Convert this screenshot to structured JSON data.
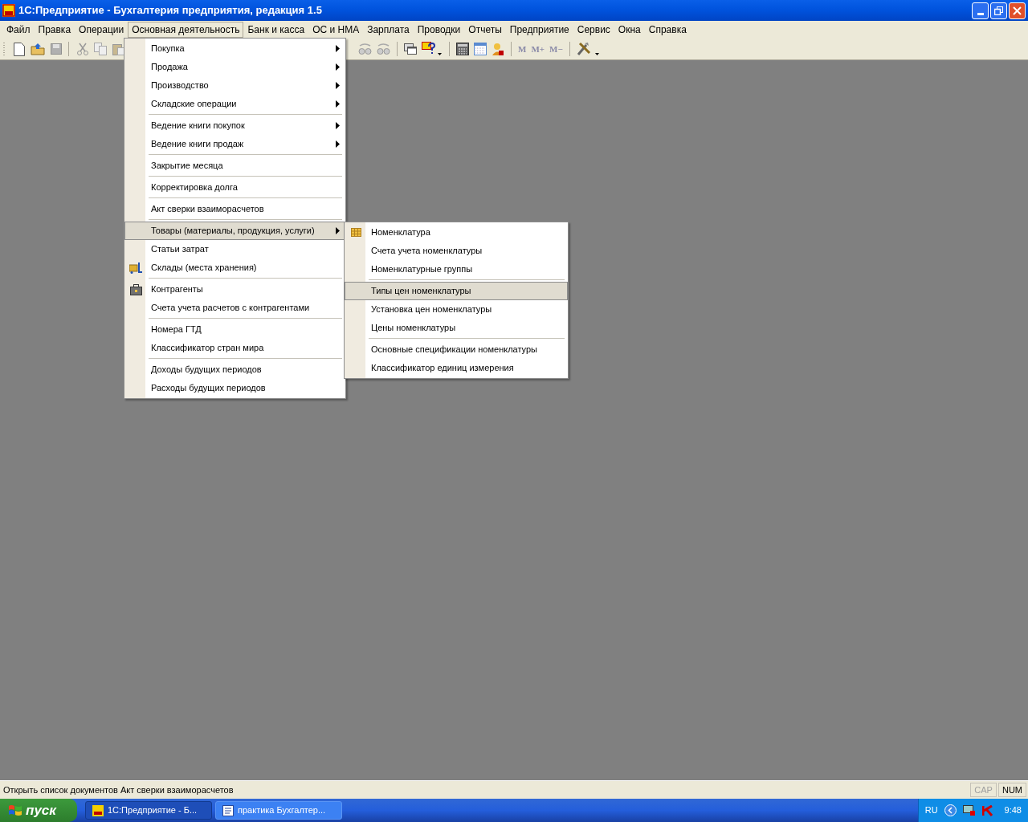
{
  "window": {
    "title": "1С:Предприятие - Бухгалтерия предприятия, редакция 1.5"
  },
  "menu_bar": [
    {
      "label": "Файл",
      "selected": false
    },
    {
      "label": "Правка",
      "selected": false
    },
    {
      "label": "Операции",
      "selected": false
    },
    {
      "label": "Основная деятельность",
      "selected": true
    },
    {
      "label": "Банк и касса",
      "selected": false
    },
    {
      "label": "ОС и НМА",
      "selected": false
    },
    {
      "label": "Зарплата",
      "selected": false
    },
    {
      "label": "Проводки",
      "selected": false
    },
    {
      "label": "Отчеты",
      "selected": false
    },
    {
      "label": "Предприятие",
      "selected": false
    },
    {
      "label": "Сервис",
      "selected": false
    },
    {
      "label": "Окна",
      "selected": false
    },
    {
      "label": "Справка",
      "selected": false
    }
  ],
  "toolbar": {
    "memory_buttons": [
      "M",
      "M+",
      "M−"
    ]
  },
  "menu": {
    "sections": [
      [
        {
          "label": "Покупка",
          "submenu": true,
          "selected": false
        },
        {
          "label": "Продажа",
          "submenu": true,
          "selected": false
        },
        {
          "label": "Производство",
          "submenu": true,
          "selected": false
        },
        {
          "label": "Складские операции",
          "submenu": true,
          "selected": false
        }
      ],
      [
        {
          "label": "Ведение книги покупок",
          "submenu": true,
          "selected": false
        },
        {
          "label": "Ведение книги продаж",
          "submenu": true,
          "selected": false
        }
      ],
      [
        {
          "label": "Закрытие месяца",
          "submenu": false,
          "selected": false
        }
      ],
      [
        {
          "label": "Корректировка долга",
          "submenu": false,
          "selected": false
        }
      ],
      [
        {
          "label": "Акт сверки взаиморасчетов",
          "submenu": false,
          "selected": false
        }
      ],
      [
        {
          "label": "Товары (материалы, продукция, услуги)",
          "submenu": true,
          "selected": true
        },
        {
          "label": "Статьи затрат",
          "submenu": false,
          "selected": false
        },
        {
          "label": "Склады (места хранения)",
          "submenu": false,
          "selected": false,
          "kind": "warehouse"
        }
      ],
      [
        {
          "label": "Контрагенты",
          "submenu": false,
          "selected": false,
          "kind": "briefcase"
        },
        {
          "label": "Счета учета расчетов с контрагентами",
          "submenu": false,
          "selected": false
        }
      ],
      [
        {
          "label": "Номера ГТД",
          "submenu": false,
          "selected": false
        },
        {
          "label": "Классификатор стран мира",
          "submenu": false,
          "selected": false
        }
      ],
      [
        {
          "label": "Доходы будущих периодов",
          "submenu": false,
          "selected": false
        },
        {
          "label": "Расходы будущих периодов",
          "submenu": false,
          "selected": false
        }
      ]
    ]
  },
  "submenu": {
    "sections": [
      [
        {
          "label": "Номенклатура",
          "submenu": false,
          "selected": false,
          "kind": "grid"
        },
        {
          "label": "Счета учета номенклатуры",
          "submenu": false,
          "selected": false
        },
        {
          "label": "Номенклатурные группы",
          "submenu": false,
          "selected": false
        }
      ],
      [
        {
          "label": "Типы цен номенклатуры",
          "submenu": false,
          "selected": true
        },
        {
          "label": "Установка цен номенклатуры",
          "submenu": false,
          "selected": false
        },
        {
          "label": "Цены номенклатуры",
          "submenu": false,
          "selected": false
        }
      ],
      [
        {
          "label": "Основные спецификации номенклатуры",
          "submenu": false,
          "selected": false
        },
        {
          "label": "Классификатор единиц измерения",
          "submenu": false,
          "selected": false
        }
      ]
    ]
  },
  "status_bar": {
    "text": "Открыть список документов Акт сверки взаиморасчетов",
    "indicators": [
      {
        "label": "CAP",
        "on": false
      },
      {
        "label": "NUM",
        "on": true
      }
    ]
  },
  "taskbar": {
    "start": "пуск",
    "tasks": [
      {
        "label": "1С:Предприятие - Б...",
        "selected": true
      },
      {
        "label": "практика Бухгалтер...",
        "selected": false
      }
    ],
    "language": "RU",
    "clock": "9:48"
  }
}
